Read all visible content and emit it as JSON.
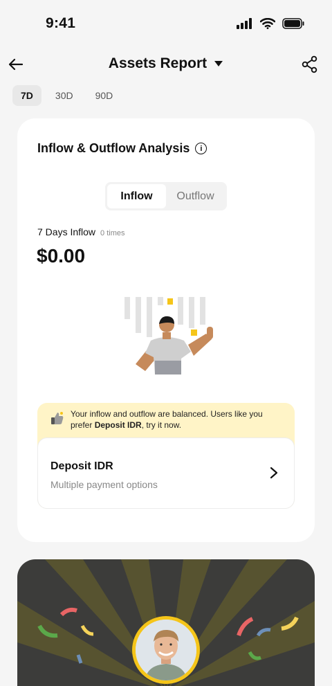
{
  "status_bar": {
    "time": "9:41"
  },
  "nav": {
    "title": "Assets Report"
  },
  "period_tabs": [
    {
      "label": "7D",
      "active": true
    },
    {
      "label": "30D",
      "active": false
    },
    {
      "label": "90D",
      "active": false
    }
  ],
  "analysis": {
    "title": "Inflow & Outflow Analysis",
    "info_glyph": "i",
    "toggle": {
      "inflow": "Inflow",
      "outflow": "Outflow",
      "selected": "Inflow"
    },
    "inflow_label": "7 Days Inflow",
    "inflow_count": "0 times",
    "amount": "$0.00"
  },
  "tip": {
    "text_before": "Your inflow and outflow are balanced. Users like you prefer ",
    "highlight": "Deposit IDR",
    "text_after": ", try it now."
  },
  "deposit": {
    "title": "Deposit IDR",
    "subtitle": "Multiple payment options"
  },
  "colors": {
    "accent_yellow": "#f5c519",
    "tip_background": "#fff4c7",
    "banner_background": "#3c3c3a"
  },
  "icons": [
    "back-arrow-icon",
    "caret-down-icon",
    "share-icon",
    "info-icon",
    "thumbs-up-icon",
    "chevron-right-icon"
  ]
}
